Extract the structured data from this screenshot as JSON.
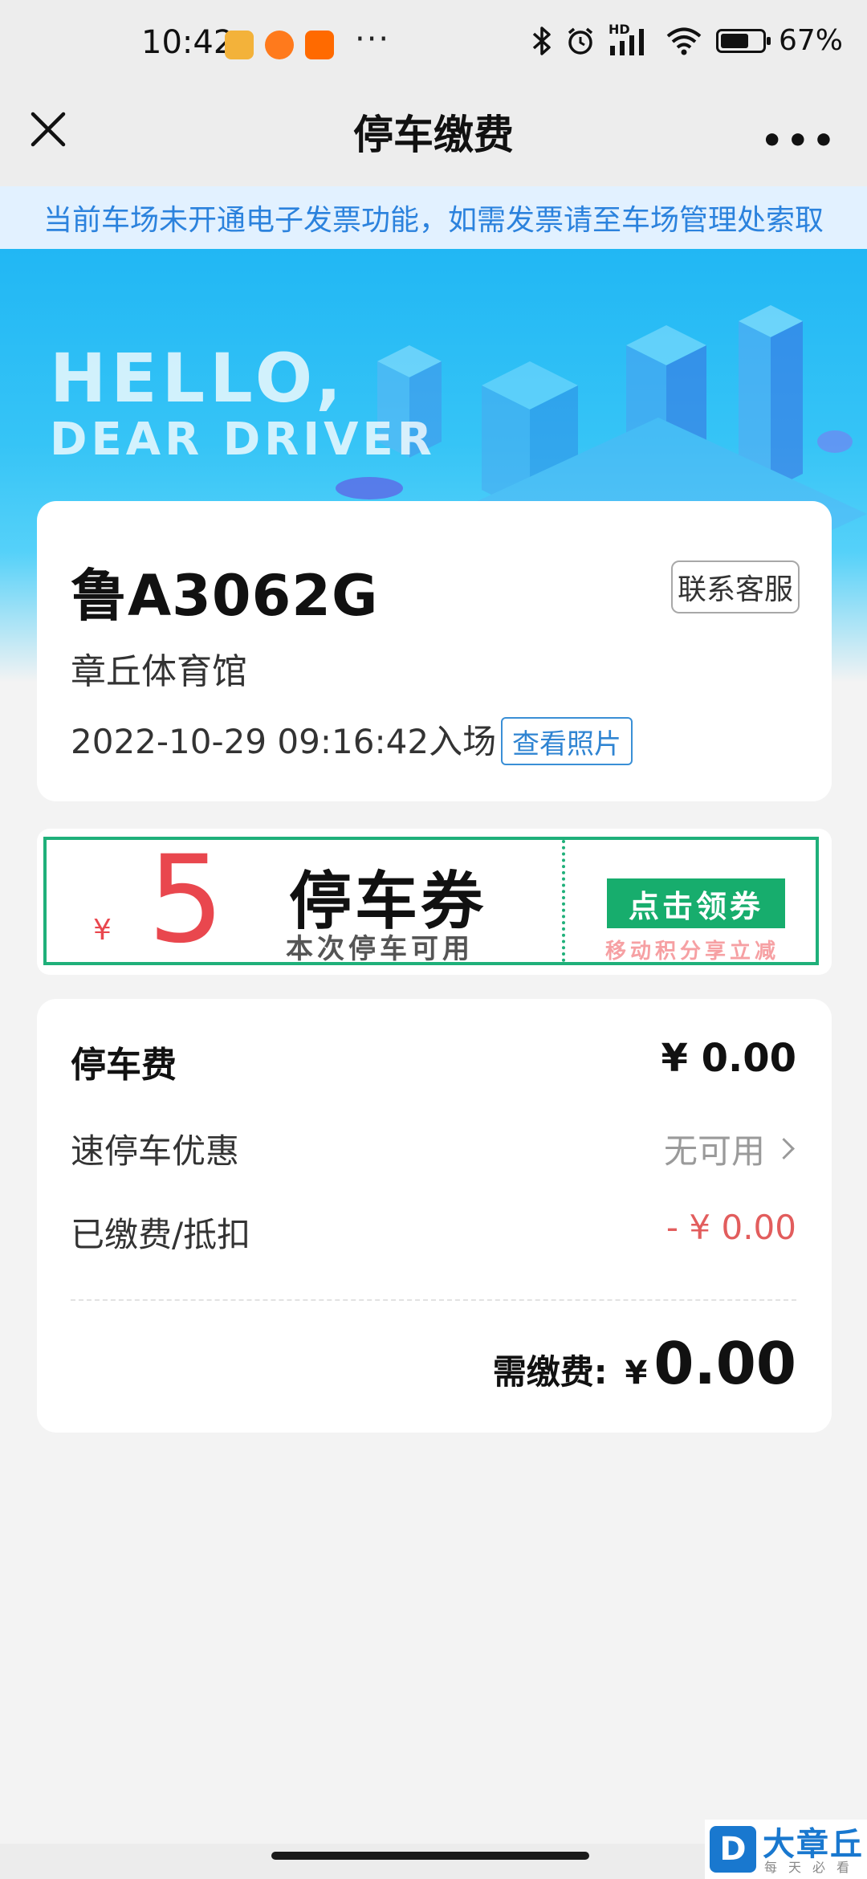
{
  "status_bar": {
    "time": "10:42",
    "more": "···",
    "battery_level": 0.67,
    "battery_text": "67%",
    "network": "HD",
    "icons": [
      "weibo-icon",
      "taobao-icon",
      "mi-icon",
      "bluetooth-icon",
      "alarm-icon",
      "signal-icon",
      "wifi-icon",
      "battery-icon"
    ]
  },
  "nav": {
    "title": "停车缴费",
    "close_icon": "close-icon",
    "more_icon": "more-icon",
    "more": "•••"
  },
  "notice": "当前车场未开通电子发票功能，如需发票请至车场管理处索取",
  "banner": {
    "line1": "HELLO,",
    "line2": "DEAR DRIVER"
  },
  "car": {
    "plate": "鲁A3062G",
    "contact_button": "联系客服",
    "location": "章丘体育馆",
    "entry_time": "2022-10-29 09:16:42入场",
    "photo_button": "查看照片"
  },
  "coupon": {
    "currency": "¥",
    "amount": "5",
    "title": "停车券",
    "subtitle": "本次停车可用",
    "claim_button": "点击领券",
    "claim_note": "移动积分享立减"
  },
  "fees": {
    "parking_label": "停车费",
    "parking_value": "¥ 0.00",
    "discount_label": "速停车优惠",
    "discount_value": "无可用",
    "paid_label": "已缴费/抵扣",
    "paid_value": "- ¥ 0.00",
    "due_label": "需缴费:",
    "due_currency": "¥",
    "due_amount": "0.00"
  },
  "watermark": {
    "logo": "D",
    "name": "大章丘",
    "tagline": "每天必看"
  },
  "colors": {
    "accent_blue": "#2b82dd",
    "coupon_green": "#1fb07a",
    "coupon_red": "#e9474e",
    "notice_bg": "#e2f1ff"
  }
}
